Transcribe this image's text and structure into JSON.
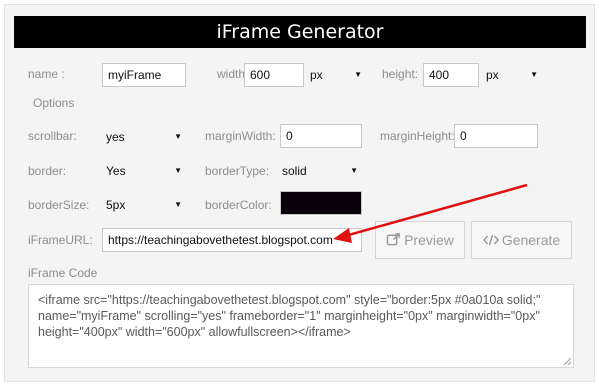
{
  "header": {
    "title": "iFrame Generator"
  },
  "row1": {
    "name_label": "name :",
    "name_value": "myiFrame",
    "width_label": "width:",
    "width_value": "600",
    "width_unit": "px",
    "height_label": "height:",
    "height_value": "400",
    "height_unit": "px"
  },
  "options_label": "Options",
  "scrollbar": {
    "label": "scrollbar:",
    "value": "yes"
  },
  "marginWidth": {
    "label": "marginWidth:",
    "value": "0"
  },
  "marginHeight": {
    "label": "marginHeight:",
    "value": "0"
  },
  "border": {
    "label": "border:",
    "value": "Yes"
  },
  "borderType": {
    "label": "borderType:",
    "value": "solid"
  },
  "borderSize": {
    "label": "borderSize:",
    "value": "5px"
  },
  "borderColor": {
    "label": "borderColor:",
    "color": "#0a010a"
  },
  "iframeUrl": {
    "label": "iFrameURL:",
    "value": "https://teachingabovethetest.blogspot.com"
  },
  "buttons": {
    "preview": "Preview",
    "generate": "Generate"
  },
  "code": {
    "label": "iFrame Code",
    "value": "<iframe src=\"https://teachingabovethetest.blogspot.com\" style=\"border:5px #0a010a solid;\" name=\"myiFrame\" scrolling=\"yes\" frameborder=\"1\" marginheight=\"0px\" marginwidth=\"0px\" height=\"400px\" width=\"600px\" allowfullscreen></iframe>"
  },
  "colors": {
    "header_bg": "#000000",
    "annotation_arrow": "#e01010"
  },
  "icons": {
    "preview": "external-link-icon",
    "generate": "code-icon",
    "dropdown": "caret-down-icon"
  }
}
